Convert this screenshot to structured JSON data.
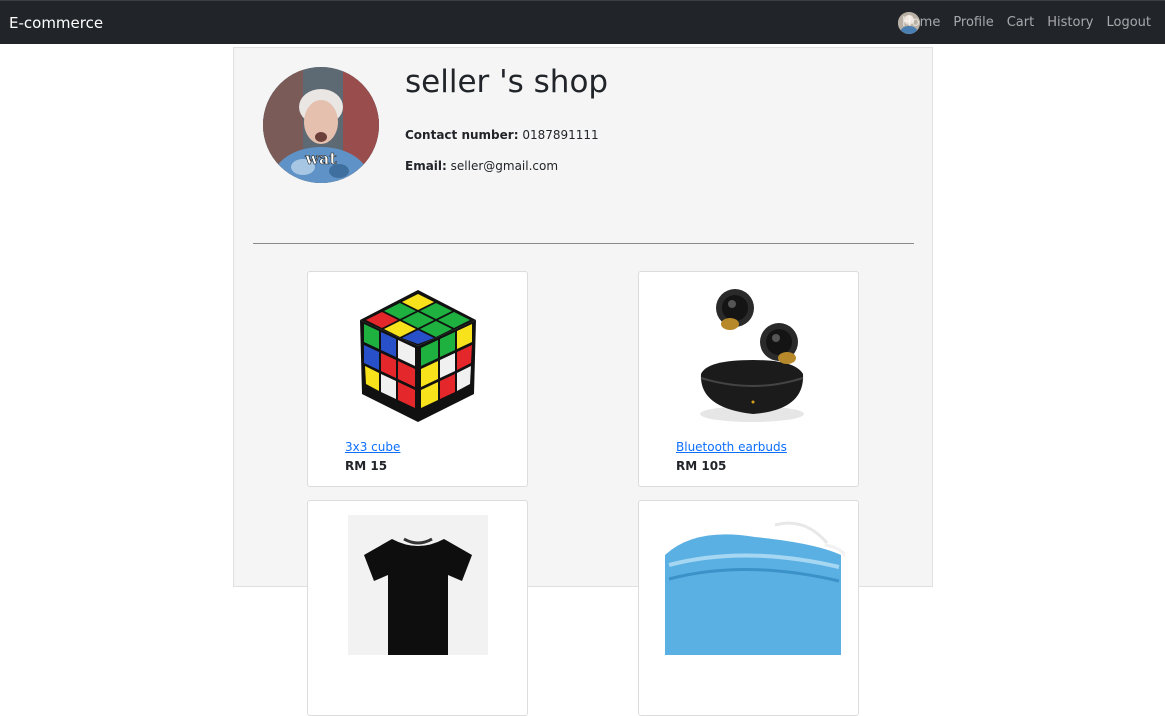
{
  "navbar": {
    "brand": "E-commerce",
    "avatar_icon": "user-avatar-icon",
    "links": [
      "Home",
      "Profile",
      "Cart",
      "History",
      "Logout"
    ]
  },
  "shop": {
    "title": "seller 's shop",
    "contact_label": "Contact number:",
    "contact_value": "0187891111",
    "email_label": "Email:",
    "email_value": "seller@gmail.com",
    "avatar_caption": "wat"
  },
  "products": [
    {
      "name": "3x3 cube",
      "price": "RM 15",
      "image_icon": "rubiks-cube-image"
    },
    {
      "name": "Bluetooth earbuds",
      "price": "RM 105",
      "image_icon": "earbuds-image"
    },
    {
      "name": "",
      "price": "",
      "image_icon": "tshirt-image"
    },
    {
      "name": "",
      "price": "",
      "image_icon": "face-mask-image"
    }
  ],
  "colors": {
    "navbar_bg": "#212529",
    "link": "#0d6efd",
    "panel_bg": "#f5f5f5"
  }
}
